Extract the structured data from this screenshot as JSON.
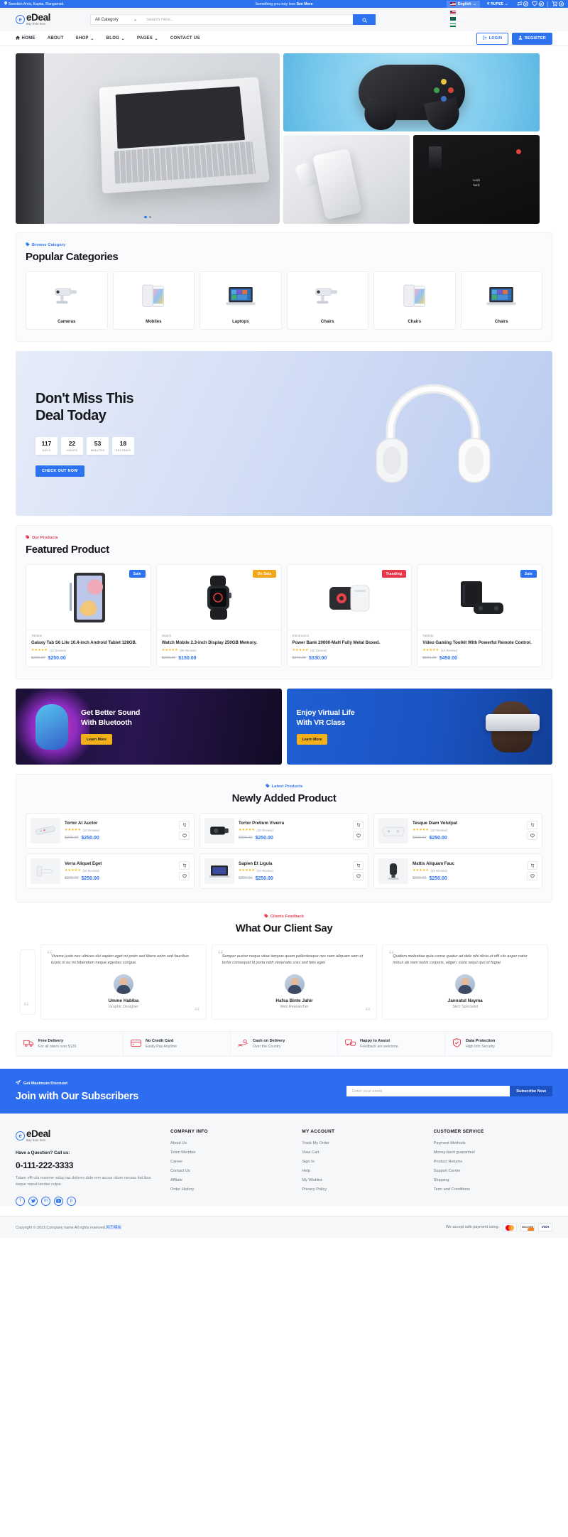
{
  "topbar": {
    "location": "Swedish Area, Kaptai, Rangamati.",
    "promo_text": "Something you may love ",
    "promo_link": "See More",
    "language": "English",
    "language_options": [
      "English",
      "Bangla",
      "Arabic"
    ],
    "currency": "RUPEE",
    "compare_count": "3",
    "wishlist_count": "3",
    "cart_count": "3"
  },
  "header": {
    "brand": "eDeal",
    "brand_tagline": "Buy from here",
    "category_select": "All Category",
    "search_placeholder": "Search Here...",
    "search_value": ""
  },
  "nav": {
    "items": [
      {
        "label": "HOME",
        "icon": "home-icon",
        "caret": false
      },
      {
        "label": "ABOUT",
        "icon": "",
        "caret": false
      },
      {
        "label": "SHOP",
        "icon": "",
        "caret": true
      },
      {
        "label": "BLOG",
        "icon": "",
        "caret": true
      },
      {
        "label": "PAGES",
        "icon": "",
        "caret": true
      },
      {
        "label": "CONTACT US",
        "icon": "",
        "caret": false
      }
    ],
    "login_label": "LOGIN",
    "register_label": "REGISTER"
  },
  "categories_section": {
    "eyebrow": "Browse Category",
    "title": "Popular Categories",
    "items": [
      {
        "name": "Cameras"
      },
      {
        "name": "Mobiles"
      },
      {
        "name": "Laptops"
      },
      {
        "name": "Chairs"
      },
      {
        "name": "Chairs"
      },
      {
        "name": "Chairs"
      }
    ]
  },
  "deal": {
    "title_line1": "Don't Miss This",
    "title_line2": "Deal Today",
    "countdown": [
      {
        "value": "117",
        "label": "DAYS"
      },
      {
        "value": "22",
        "label": "HOURS"
      },
      {
        "value": "53",
        "label": "MINUTES"
      },
      {
        "value": "18",
        "label": "SECONDS"
      }
    ],
    "button": "CHECK OUT NOW"
  },
  "featured": {
    "eyebrow": "Our Products",
    "title": "Featured Product",
    "products": [
      {
        "ribbon": "Sale",
        "ribbon_type": "r-sale",
        "category": "Tablets",
        "name": "Galaxy Tab S6 Lite 10.4-inch Android Tablet 128GB.",
        "stars": "★★★★★",
        "reviews": "(10 Review)",
        "price_old": "$300.00",
        "price_new": "$250.00"
      },
      {
        "ribbon": "On Sale",
        "ribbon_type": "r-onsale",
        "category": "Watch",
        "name": "Watch Mobile 2.3-inch Display 250GB Memory.",
        "stars": "★★★★★",
        "reviews": "(90 Review)",
        "price_old": "$200.00",
        "price_new": "$150.00"
      },
      {
        "ribbon": "Tranding",
        "ribbon_type": "r-trend",
        "category": "Electronics",
        "name": "Power Bank 20000-MaH Fully Metal Boxed.",
        "stars": "★★★★★",
        "reviews": "(32 Review)",
        "price_old": "$340.00",
        "price_new": "$330.00"
      },
      {
        "ribbon": "Sale",
        "ribbon_type": "r-sale",
        "category": "Tablets",
        "name": "Video Gaming Toolkit With Powerful Remote Control.",
        "stars": "★★★★★",
        "reviews": "(10 Review)",
        "price_old": "$560.00",
        "price_new": "$450.00"
      }
    ]
  },
  "promos": [
    {
      "title_line1": "Get Better Sound",
      "title_line2": "With Bluetooth",
      "button": "Learn More"
    },
    {
      "title_line1": "Enjoy Virtual Life",
      "title_line2": "With VR Class",
      "button": "Learn More"
    }
  ],
  "newly": {
    "eyebrow": "Latest Products",
    "title": "Newly Added Product",
    "products": [
      {
        "name": "Tortor At Auctor",
        "stars": "★★★★★",
        "reviews": "(10 Review)",
        "price_old": "$300.00",
        "price_new": "$250.00"
      },
      {
        "name": "Tortor Pretium Viverra",
        "stars": "★★★★★",
        "reviews": "(10 Review)",
        "price_old": "$300.00",
        "price_new": "$250.00"
      },
      {
        "name": "Tesque Diam Volutpat",
        "stars": "★★★★★",
        "reviews": "(10 Review)",
        "price_old": "$300.00",
        "price_new": "$250.00"
      },
      {
        "name": "Verra Aliquet Eget",
        "stars": "★★★★★",
        "reviews": "(10 Review)",
        "price_old": "$300.00",
        "price_new": "$250.00"
      },
      {
        "name": "Sapien Et Ligula",
        "stars": "★★★★★",
        "reviews": "(10 Review)",
        "price_old": "$300.00",
        "price_new": "$250.00"
      },
      {
        "name": "Mattis Aliquam Fauc",
        "stars": "★★★★★",
        "reviews": "(10 Review)",
        "price_old": "$300.00",
        "price_new": "$250.00"
      }
    ]
  },
  "testimonials": {
    "eyebrow": "Clients Feedback",
    "title": "What Our Client Say",
    "items": [
      {
        "text": "Viverra justo nec ultrices dui sapien eget mi proin sed libero enim sed faucibus turpis in eu mi bibendum neque egestas congue.",
        "name": "Umme Habiba",
        "role": "Graphic Designer"
      },
      {
        "text": "Semper auctor neque vitae tempus quam pellentesque nec nam aliquam sem et tortor consequat id porta nibh venenatis cras sed felis eget.",
        "name": "Hafsa Binte Jahir",
        "role": "Web Researcher"
      },
      {
        "text": "Quidem molestiae quia conse quatur ad dele nihi dicta ut offi ciis asper natur minus ab nam nobis corporis, eligen. iusto sequi quo id fugiat.",
        "name": "Jannatul Nayma",
        "role": "SEO Specialist"
      }
    ]
  },
  "features": [
    {
      "title": "Free Delivery",
      "sub": "For all oders over $120",
      "icon": "truck-icon"
    },
    {
      "title": "No Credit Card",
      "sub": "Easily Pay Anytime",
      "icon": "credit-card-icon"
    },
    {
      "title": "Cash on Delivery",
      "sub": "Over the Country",
      "icon": "hand-cash-icon"
    },
    {
      "title": "Happy to Assist",
      "sub": "Feedback are welcome",
      "icon": "chat-icon"
    },
    {
      "title": "Data Protection",
      "sub": "High Info Security",
      "icon": "shield-icon"
    }
  ],
  "subscribe": {
    "eyebrow": "Get Maximum Discount",
    "title": "Join with Our Subscribers",
    "placeholder": "Enter your email",
    "input_value": "",
    "button": "Subscribe Now"
  },
  "footer": {
    "brand": "eDeal",
    "brand_tagline": "Buy from here",
    "question": "Have a Question? Call us:",
    "phone": "0-111-222-3333",
    "description": "Totam offi ciis maxime volup tas dolores dolo rem accua ntium necess itat ibus itaque repud iandae culpa.",
    "socials": [
      "facebook-icon",
      "twitter-icon",
      "linkedin-icon",
      "youtube-icon",
      "pinterest-icon"
    ],
    "columns": [
      {
        "heading": "COMPANY INFO",
        "links": [
          "About Us",
          "Team Member",
          "Career",
          "Contact Us",
          "Affilate",
          "Order History"
        ]
      },
      {
        "heading": "MY ACCOUNT",
        "links": [
          "Track My Order",
          "View Cart",
          "Sign In",
          "Help",
          "My Wishlist",
          "Privacy Policy"
        ]
      },
      {
        "heading": "CUSTOMER SERVICE",
        "links": [
          "Payment Methods",
          "Money-back guarantee!",
          "Product Returns",
          "Support Center",
          "Shipping",
          "Term and Conditions"
        ]
      }
    ],
    "copyright": "Copyright © 2023.Company name All rights reserved.",
    "copyright_link": "网页模板",
    "payment_label": "We accept safe payment using:",
    "payment_cards": [
      "mastercard",
      "discover",
      "VISA"
    ]
  },
  "colors": {
    "brand_blue": "#2d72ef",
    "accent_red": "#e8374a",
    "accent_yellow": "#f2a71b",
    "star": "#f5b719"
  }
}
